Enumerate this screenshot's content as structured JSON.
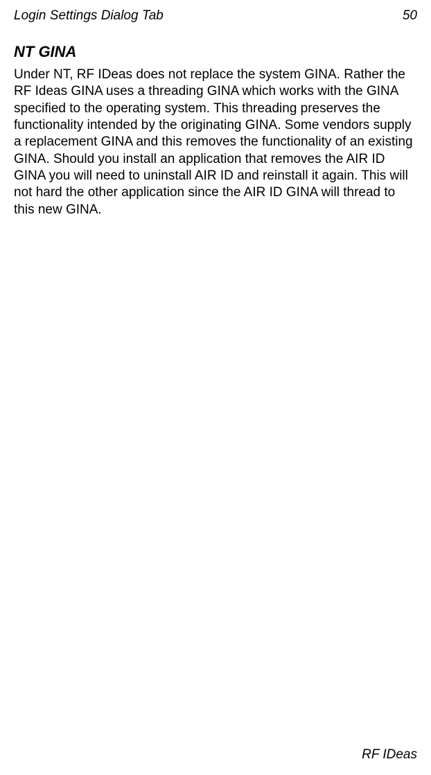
{
  "header": {
    "title": "Login Settings Dialog Tab",
    "page_number": "50"
  },
  "section": {
    "title": "NT GINA",
    "paragraph": "Under NT, RF IDeas does not replace the system GINA.  Rather the RF Ideas GINA uses a threading GINA which works with the GINA specified to the operating system.  This threading preserves the functionality intended by the originating GINA.  Some vendors supply a replacement GINA and this removes the functionality of an existing GINA.  Should you install an application that removes the AIR ID GINA you will need to uninstall AIR ID  and reinstall it again. This will not hard the other application since the AIR ID GINA will thread to this new GINA."
  },
  "footer": {
    "text": "RF IDeas"
  }
}
